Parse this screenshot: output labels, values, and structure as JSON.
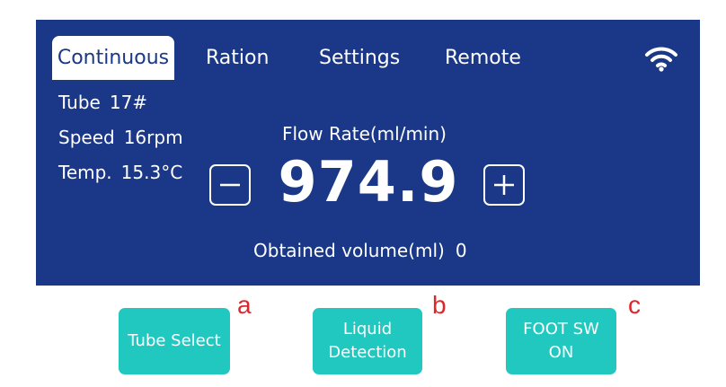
{
  "tabs": [
    {
      "label": "Continuous",
      "active": true
    },
    {
      "label": "Ration",
      "active": false
    },
    {
      "label": "Settings",
      "active": false
    },
    {
      "label": "Remote",
      "active": false
    }
  ],
  "status_icon": "wifi-icon",
  "info": {
    "tube": {
      "label": "Tube",
      "value": "17#"
    },
    "speed": {
      "label": "Speed",
      "value": "16rpm"
    },
    "temp": {
      "label": "Temp.",
      "value": "15.3°C"
    }
  },
  "flow": {
    "label": "Flow Rate(ml/min)",
    "value": "974.9",
    "decrement_icon": "minus-icon",
    "increment_icon": "plus-icon"
  },
  "volume": {
    "label": "Obtained volume(ml)",
    "value": "0"
  },
  "buttons": {
    "tube_select": {
      "line1": "Tube Select",
      "marker": "a"
    },
    "liquid_detection": {
      "line1": "Liquid",
      "line2": "Detection",
      "marker": "b"
    },
    "foot_sw": {
      "line1": "FOOT SW",
      "line2": "ON",
      "marker": "c"
    }
  },
  "colors": {
    "panel": "#1b3888",
    "button": "#20c8bf",
    "marker": "#e0262b"
  }
}
